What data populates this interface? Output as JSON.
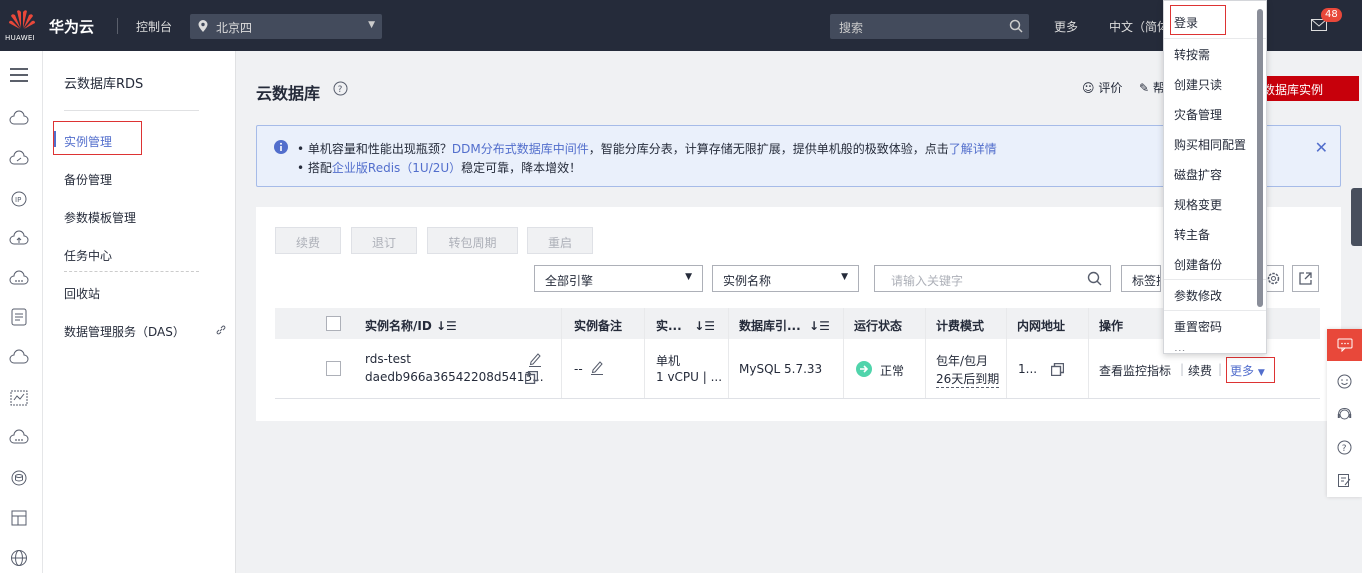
{
  "topbar": {
    "logo_text": "HUAWEI",
    "brand": "华为云",
    "console": "控制台",
    "region": "北京四",
    "search_placeholder": "搜索",
    "more": "更多",
    "language": "中文（简体",
    "mail_badge": "48"
  },
  "sidebar": {
    "title": "云数据库RDS",
    "items": [
      {
        "label": "实例管理"
      },
      {
        "label": "备份管理"
      },
      {
        "label": "参数模板管理"
      },
      {
        "label": "任务中心"
      },
      {
        "label": "回收站"
      },
      {
        "label": "数据管理服务（DAS）"
      }
    ]
  },
  "main": {
    "title": "云数据库",
    "rate": "评价",
    "help": "帮",
    "buy_button": "数据库实例",
    "notice": {
      "line1_pre": "• 单机容量和性能出现瓶颈？",
      "line1_link": "DDM分布式数据库中间件",
      "line1_mid": "，智能分库分表，计算存储无限扩展，提供单机般的极致体验，点击",
      "line1_link2": "了解详情",
      "line2_pre": "• 搭配",
      "line2_link": "企业版Redis（1U/2U）",
      "line2_post": "稳定可靠，降本增效！"
    },
    "buttons": [
      "续费",
      "退订",
      "转包周期",
      "重启"
    ],
    "engine_select": "全部引擎",
    "name_select": "实例名称",
    "keyword_placeholder": "请输入关键字",
    "tag_select": "标签搜",
    "table": {
      "headers": [
        "实例名称/ID",
        "实例备注",
        "实...",
        "数据库引...",
        "运行状态",
        "计费模式",
        "内网地址",
        "操作"
      ],
      "row": {
        "name": "rds-test",
        "id": "daedb966a36542208d5413...",
        "remark": "--",
        "type1": "单机",
        "type2": "1 vCPU | ...",
        "engine": "MySQL 5.7.33",
        "status": "正常",
        "billing1": "包年/包月",
        "billing2": "26天后到期",
        "ip": "1...",
        "op_monitor": "查看监控指标",
        "op_renew": "续费",
        "op_more": "更多"
      }
    }
  },
  "dropdown": {
    "items": [
      "登录",
      "转按需",
      "创建只读",
      "灾备管理",
      "购买相同配置",
      "磁盘扩容",
      "规格变更",
      "转主备",
      "创建备份",
      "参数修改",
      "重置密码",
      "..."
    ]
  },
  "colors": {
    "brand_red": "#c7000b",
    "topbar": "#252b3a",
    "link": "#526ecc",
    "status_green": "#50d4ab"
  }
}
